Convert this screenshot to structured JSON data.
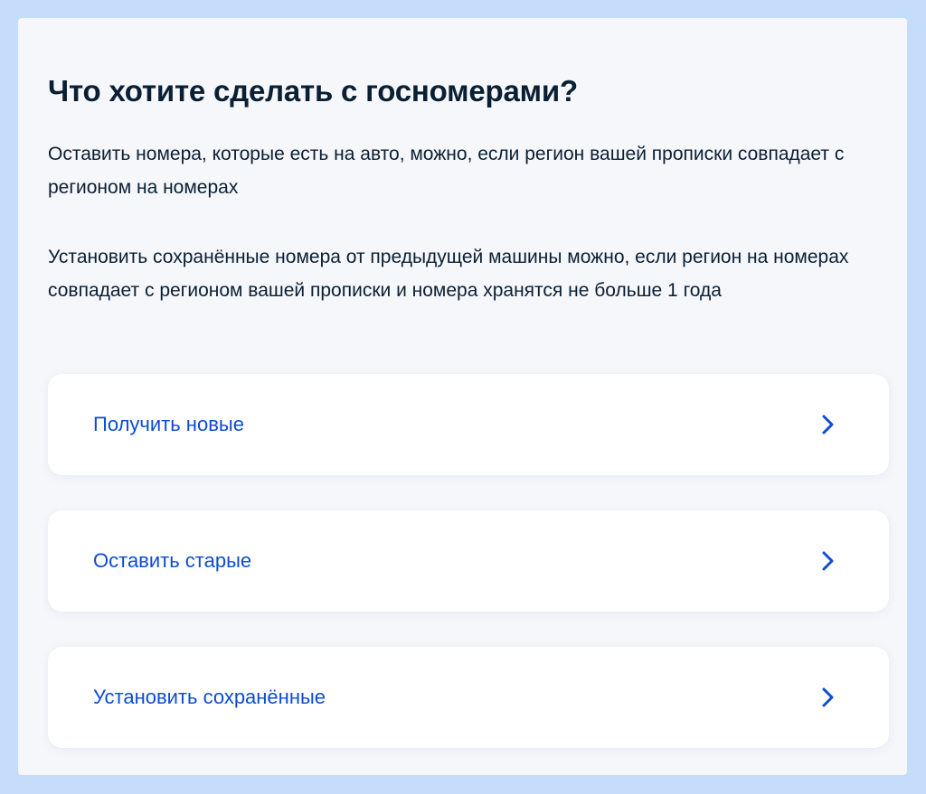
{
  "page": {
    "title": "Что хотите сделать с госномерами?",
    "paragraphs": [
      "Оставить номера, которые есть на авто, можно, если регион вашей прописки совпадает с регионом на номерах",
      "Установить сохранённые номера от предыдущей машины можно, если регион на номерах совпадает с регионом вашей прописки и номера хранятся не больше 1 года"
    ]
  },
  "options": [
    {
      "label": "Получить новые",
      "icon": "chevron-right-icon"
    },
    {
      "label": "Оставить старые",
      "icon": "chevron-right-icon"
    },
    {
      "label": "Установить сохранённые",
      "icon": "chevron-right-icon"
    }
  ],
  "colors": {
    "outer_background": "#c5dcfb",
    "panel_background": "#f5f7fb",
    "card_background": "#ffffff",
    "text": "#0b1f33",
    "link": "#0d4cd3"
  }
}
